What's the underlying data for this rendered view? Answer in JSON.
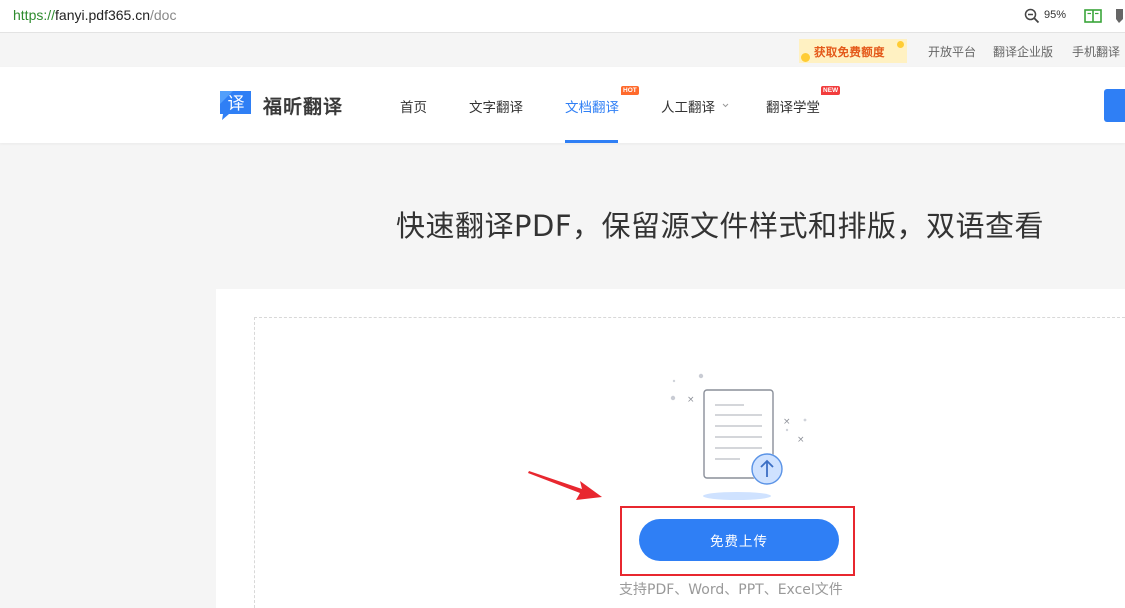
{
  "browser": {
    "url_scheme": "https://",
    "url_host": "fanyi.pdf365.cn",
    "url_path": "/doc",
    "zoom": "95%"
  },
  "util_bar": {
    "promo_label": "获取免费额度",
    "links": [
      "开放平台",
      "翻译企业版",
      "手机翻译"
    ]
  },
  "header": {
    "logo_char": "译",
    "logo_text": "福昕翻译",
    "nav": [
      {
        "label": "首页"
      },
      {
        "label": "文字翻译"
      },
      {
        "label": "文档翻译",
        "badge": "HOT"
      },
      {
        "label": "人工翻译"
      },
      {
        "label": "翻译学堂",
        "badge": "NEW"
      }
    ],
    "active_nav": "文档翻译"
  },
  "hero": {
    "title": "快速翻译PDF，保留源文件样式和排版，双语查看"
  },
  "upload": {
    "button_label": "免费上传",
    "support_text": "支持PDF、Word、PPT、Excel文件"
  },
  "colors": {
    "accent": "#2f7ff5",
    "annotation_red": "#e8272f",
    "promo_bg": "#fff1c2",
    "promo_text": "#e45a1b",
    "hot_badge": "#ff6a2c",
    "new_badge": "#f23c3c"
  }
}
